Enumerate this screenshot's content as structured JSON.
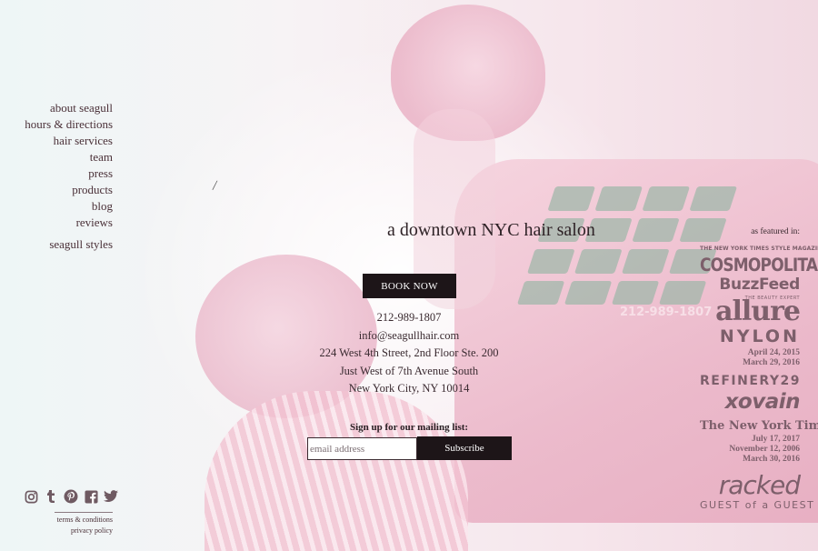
{
  "nav": {
    "items": [
      {
        "label": "about seagull"
      },
      {
        "label": "hours & directions"
      },
      {
        "label": "hair services"
      },
      {
        "label": "team"
      },
      {
        "label": "press"
      },
      {
        "label": "products"
      },
      {
        "label": "blog"
      },
      {
        "label": "reviews"
      }
    ],
    "extra": {
      "label": "seagull styles"
    }
  },
  "decor": {
    "slash": "/"
  },
  "hero": {
    "tagline": "a downtown NYC hair salon",
    "book_label": "BOOK NOW"
  },
  "contact": {
    "phone": "212-989-1807",
    "email": "info@seagullhair.com",
    "address_line1": "224 West 4th Street, 2nd Floor Ste. 200",
    "address_line2": "Just West of 7th Avenue South",
    "address_line3": "New York City, NY 10014"
  },
  "mailing": {
    "label": "Sign up for our mailing list:",
    "placeholder": "email address",
    "subscribe_label": "Subscribe"
  },
  "social": {
    "icons": [
      "instagram-icon",
      "tumblr-icon",
      "pinterest-icon",
      "facebook-icon",
      "twitter-icon"
    ]
  },
  "footer": {
    "terms": "terms & conditions",
    "privacy": "privacy policy"
  },
  "press": {
    "featured_label": "as featured in:",
    "nytsm": "THE NEW YORK TIMES STYLE MAGAZINE",
    "cosmopolitan": "COSMOPOLITAN",
    "buzzfeed": "BuzzFeed",
    "allure_sub": "THE BEAUTY EXPERT",
    "allure": "allure",
    "nylon": "NYLON",
    "nylon_dates": [
      "April 24, 2015",
      "March 29, 2016"
    ],
    "refinery29": "REFINERY29",
    "xovain": "xovain",
    "nyt": "The New York Times",
    "nyt_dates": [
      "July 17, 2017",
      "November 12, 2006",
      "March 30, 2016"
    ],
    "racked": "racked",
    "guest_of_guest": "GUEST of a GUEST"
  },
  "background": {
    "phone_number_label": "212-989-1807",
    "brand_color": "#1d1518",
    "accent_pink": "#eab3c6",
    "logo_color": "#7d5f6b"
  }
}
